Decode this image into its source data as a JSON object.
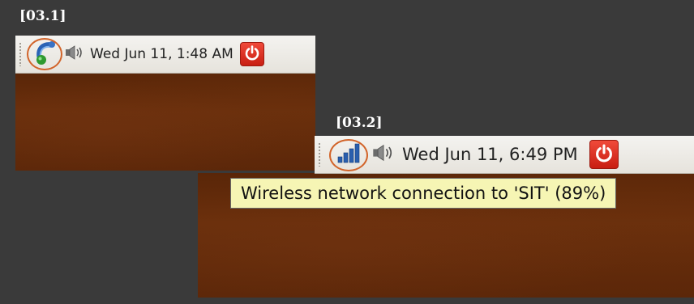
{
  "captions": {
    "first": "[03.1]",
    "second": "[03.2]"
  },
  "screenshot_1": {
    "network_icon": "network-disconnected-icon",
    "volume_icon": "speaker-icon",
    "clock": "Wed Jun 11,  1:48 AM",
    "power_icon": "power-icon"
  },
  "screenshot_2": {
    "network_icon": "wireless-signal-icon",
    "volume_icon": "speaker-icon",
    "clock": "Wed Jun 11,  6:49 PM",
    "power_icon": "power-icon",
    "tooltip": "Wireless network connection to 'SIT' (89%)",
    "signal_strength_percent": 89
  },
  "colors": {
    "highlight_circle": "#d2642a",
    "tooltip_bg": "#f6f5b4",
    "panel_bg": "#ece9e3",
    "desktop_brown": "#5e280a",
    "power_red": "#e02f20"
  }
}
